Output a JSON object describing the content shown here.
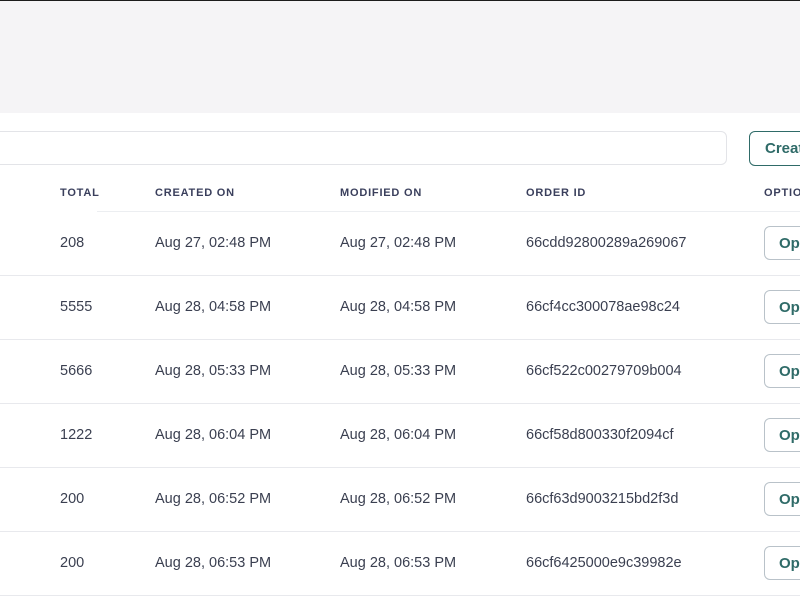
{
  "toolbar": {
    "search_value": "",
    "create_label": "Create"
  },
  "table": {
    "columns": [
      "TOTAL",
      "CREATED ON",
      "MODIFIED ON",
      "ORDER ID",
      "OPTIONS"
    ],
    "rows": [
      {
        "total": "208",
        "created": "Aug 27, 02:48 PM",
        "modified": "Aug 27, 02:48 PM",
        "order_id": "66cdd92800289a269067",
        "option_label": "Options"
      },
      {
        "total": "5555",
        "created": "Aug 28, 04:58 PM",
        "modified": "Aug 28, 04:58 PM",
        "order_id": "66cf4cc300078ae98c24",
        "option_label": "Options"
      },
      {
        "total": "5666",
        "created": "Aug 28, 05:33 PM",
        "modified": "Aug 28, 05:33 PM",
        "order_id": "66cf522c00279709b004",
        "option_label": "Options"
      },
      {
        "total": "1222",
        "created": "Aug 28, 06:04 PM",
        "modified": "Aug 28, 06:04 PM",
        "order_id": "66cf58d800330f2094cf",
        "option_label": "Options"
      },
      {
        "total": "200",
        "created": "Aug 28, 06:52 PM",
        "modified": "Aug 28, 06:52 PM",
        "order_id": "66cf63d9003215bd2f3d",
        "option_label": "Options"
      },
      {
        "total": "200",
        "created": "Aug 28, 06:53 PM",
        "modified": "Aug 28, 06:53 PM",
        "order_id": "66cf6425000e9c39982e",
        "option_label": "Options"
      }
    ]
  },
  "colors": {
    "accent": "#2f6b68",
    "header_background": "#f5f4f6",
    "text": "#3a3f50"
  }
}
